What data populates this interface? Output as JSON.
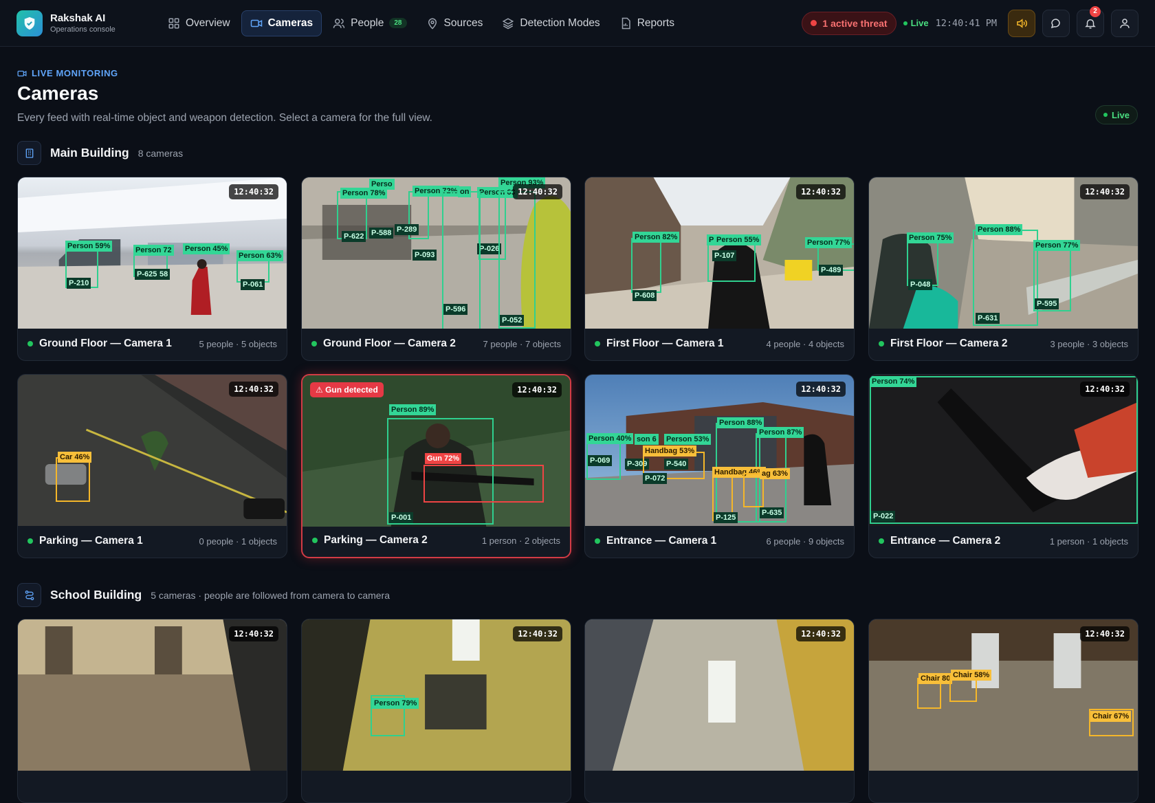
{
  "app": {
    "name": "Rakshak AI",
    "subtitle": "Operations console"
  },
  "nav": [
    {
      "label": "Overview",
      "icon": "grid-icon"
    },
    {
      "label": "Cameras",
      "icon": "camera-icon",
      "active": true
    },
    {
      "label": "People",
      "icon": "people-icon",
      "count": "28"
    },
    {
      "label": "Sources",
      "icon": "location-pin-icon"
    },
    {
      "label": "Detection Modes",
      "icon": "layers-icon"
    },
    {
      "label": "Reports",
      "icon": "report-icon"
    }
  ],
  "status": {
    "threat": "1 active threat",
    "live": "Live",
    "clock": "12:40:41 PM",
    "notifications": "2"
  },
  "page": {
    "kicker": "LIVE MONITORING",
    "title": "Cameras",
    "subtitle": "Every feed with real-time object and weapon detection. Select a camera for the full view.",
    "live_pill": "Live"
  },
  "sections": [
    {
      "title": "Main Building",
      "meta": "8 cameras",
      "cameras": [
        {
          "name": "Ground Floor — Camera 1",
          "stats": "5 people · 5 objects",
          "time": "12:40:32"
        },
        {
          "name": "Ground Floor — Camera 2",
          "stats": "7 people · 7 objects",
          "time": "12:40:32"
        },
        {
          "name": "First Floor — Camera 1",
          "stats": "4 people · 4 objects",
          "time": "12:40:32"
        },
        {
          "name": "First Floor — Camera 2",
          "stats": "3 people · 3 objects",
          "time": "12:40:32"
        },
        {
          "name": "Parking — Camera 1",
          "stats": "0 people · 1 objects",
          "time": "12:40:32"
        },
        {
          "name": "Parking — Camera 2",
          "stats": "1 person · 2 objects",
          "time": "12:40:32",
          "alert": "⚠ Gun detected"
        },
        {
          "name": "Entrance — Camera 1",
          "stats": "6 people · 9 objects",
          "time": "12:40:32"
        },
        {
          "name": "Entrance — Camera 2",
          "stats": "1 person · 1 objects",
          "time": "12:40:32"
        }
      ]
    },
    {
      "title": "School Building",
      "meta": "5 cameras · people are followed from camera to camera",
      "cameras": [
        {
          "time": "12:40:32"
        },
        {
          "time": "12:40:32"
        },
        {
          "time": "12:40:32"
        },
        {
          "time": "12:40:32"
        }
      ]
    }
  ],
  "detections": {
    "gf1": [
      [
        "Person 59%",
        "P-210"
      ],
      [
        "Person 72",
        "P-625"
      ],
      [
        "Person 45%",
        "58"
      ],
      [
        "Person 63%",
        "P-061"
      ]
    ],
    "gf2": [
      [
        "Person 78%",
        "P-622"
      ],
      [
        "Perso",
        "P-588"
      ],
      [
        "Person 72%",
        "P-289"
      ],
      [
        "Person 72%",
        "P-093"
      ],
      [
        "Person 69",
        "P-026"
      ],
      [
        "Person 73%",
        "P-596"
      ],
      [
        "Person 93%",
        "P-052"
      ],
      [
        "on",
        ""
      ]
    ],
    "ff1": [
      [
        "Person 82%",
        "P-608"
      ],
      [
        "P",
        "P-107"
      ],
      [
        "Person 55%",
        ""
      ],
      [
        "Person 77%",
        "P-489"
      ]
    ],
    "ff2": [
      [
        "Person 75%",
        "P-048"
      ],
      [
        "Person 88%",
        "P-631"
      ],
      [
        "Person 77%",
        "P-595"
      ]
    ],
    "pk1": [
      [
        "Car 46%"
      ]
    ],
    "pk2": [
      [
        "Person 89%",
        "P-001"
      ],
      [
        "Gun 72%"
      ]
    ],
    "en1": [
      [
        "Person 40%",
        "P-069"
      ],
      [
        "son 6",
        "P-309"
      ],
      [
        "Person 53%",
        "P-540"
      ],
      [
        "Handbag 53%",
        "P-072"
      ],
      [
        "Person 88%",
        ""
      ],
      [
        "Person 87%",
        ""
      ],
      [
        "Handbag 46%",
        "P-125"
      ],
      [
        "ag 63%",
        "P-635"
      ]
    ],
    "en2": [
      [
        "Person 74%",
        "P-022"
      ]
    ],
    "sb2": [
      [
        "Person 79%"
      ]
    ],
    "sb4": [
      [
        "Chair 80"
      ],
      [
        "Chair 58%"
      ],
      [
        "Chair 67%"
      ]
    ]
  },
  "colors": {
    "accent": "#60a5fa",
    "live": "#22c55e",
    "threat": "#ef4444",
    "person_box": "#2fd08f",
    "object_box": "#f5b72a"
  }
}
